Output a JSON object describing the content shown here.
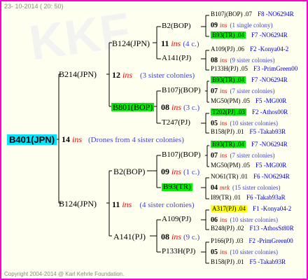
{
  "header": {
    "date": "23- 10-2014 ( 20: 50)"
  },
  "footer": {
    "copyright": "Copyright 2004-2014 @ Karl Kehrle Foundation."
  },
  "gen1": {
    "name": "B401(JPN)",
    "count": "14",
    "ins": "ins",
    "note": "(Drones from 4 sister colonies)"
  },
  "gen2": [
    {
      "name": "B214(JPN)",
      "count": "12",
      "ins": "ins",
      "note": "(3 sister colonies)"
    },
    {
      "name": "B124(JPN)",
      "count": "11",
      "ins": "ins",
      "note": "(4 sister colonies)"
    }
  ],
  "gen3": [
    {
      "name": "B124(JPN)",
      "count": "11",
      "ins": "ins",
      "note": "(4 c.)"
    },
    {
      "name": "B801(BOP)",
      "count": "08",
      "ins": "ins",
      "note": "(3 c.)"
    },
    {
      "name": "B2(BOP)",
      "count": "09",
      "ins": "ins",
      "note": "(1 c.)"
    },
    {
      "name": "A141(PJ)",
      "count": "08",
      "ins": "ins",
      "note": "(9 c.)"
    }
  ],
  "gen4": [
    {
      "name": "B2(BOP)"
    },
    {
      "name": "A141(PJ)"
    },
    {
      "name": "B107j(BOP)"
    },
    {
      "name": "T247(PJ)"
    },
    {
      "name": "B107j(BOP)"
    },
    {
      "name": "B93(TR)"
    },
    {
      "name": "A109(PJ)"
    },
    {
      "name": "P133H(PJ)"
    }
  ],
  "gen5": [
    {
      "left": "B107j(BOP) .07",
      "right": "F8 -NO6294R"
    },
    {
      "count": "09",
      "ins": "ins",
      "note": "(1 single colony)"
    },
    {
      "left": "B93(TR) .04",
      "right": "F7 -NO6294R"
    },
    {
      "left": "A109(PJ) .06",
      "right": "F2 -Konya04-2"
    },
    {
      "count": "08",
      "ins": "ins",
      "note": "(9 sister colonies)"
    },
    {
      "left": "P133H(PJ) .05",
      "right": "F3 -PrimGreen00"
    },
    {
      "left": "B93(TR) .04",
      "right": "F7 -NO6294R"
    },
    {
      "count": "07",
      "ins": "ins",
      "note": "(7 sister colonies)"
    },
    {
      "left": "MG50(PM) .05",
      "right": "F5 -MG00R"
    },
    {
      "left": "T202(PJ) .03",
      "right": "F2 -Athos00R"
    },
    {
      "count": "05",
      "ins": "ins",
      "note": "(10 sister colonies)"
    },
    {
      "left": "B158(PJ) .01",
      "right": "F5 -Takab93R"
    },
    {
      "left": "B93(TR) .04",
      "right": "F7 -NO6294R"
    },
    {
      "count": "07",
      "ins": "ins",
      "note": "(7 sister colonies)"
    },
    {
      "left": "MG50(PM) .05",
      "right": "F5 -MG00R"
    },
    {
      "left": "NO61(TR) .01",
      "right": "F6 -NO6294R"
    },
    {
      "count": "04",
      "ins": "mrk",
      "note": "(15 sister colonies)"
    },
    {
      "left": "I89(TR) .01",
      "right": "F6 -Takab93aR"
    },
    {
      "left": "A317(PJ) .04",
      "right": "F1 -Konya04-2"
    },
    {
      "count": "06",
      "ins": "ins",
      "note": "(10 sister colonies)"
    },
    {
      "left": "B248(PJ) .02",
      "right": "F13 -AthosSt80R"
    },
    {
      "left": "P166(PJ) .03",
      "right": "F2 -PrimGreen00"
    },
    {
      "count": "05",
      "ins": "ins",
      "note": "(10 sister colonies)"
    },
    {
      "left": "B158(PJ) .01",
      "right": "F5 -Takab93R"
    }
  ]
}
